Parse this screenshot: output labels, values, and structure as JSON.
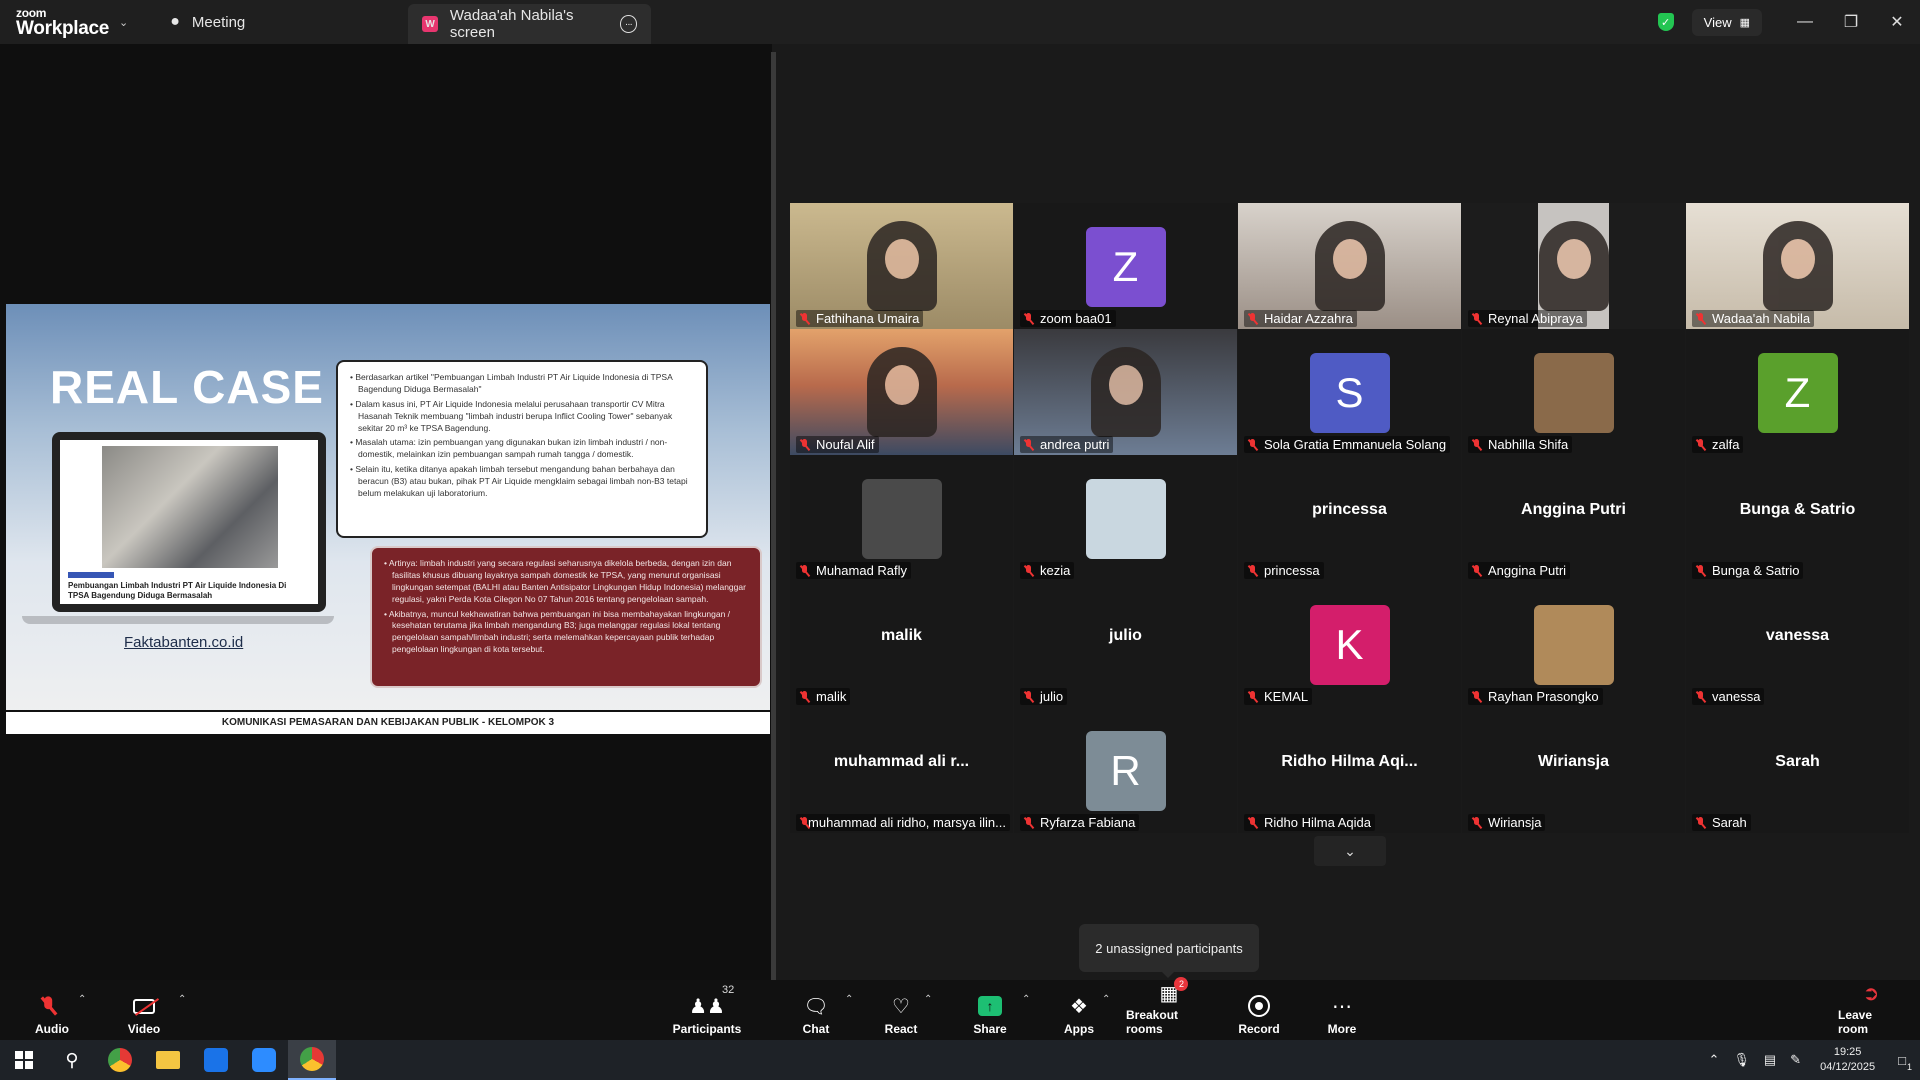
{
  "app": {
    "logo_line1": "zoom",
    "logo_line2": "Workplace",
    "tab_meeting": "Meeting",
    "tab_screen": "Wadaa'ah Nabila's screen",
    "tab_screen_badge": "W",
    "view_label": "View"
  },
  "slide": {
    "title": "REAL CASE",
    "laptop_caption": "Pembuangan Limbah Industri PT Air Liquide Indonesia Di TPSA Bagendung Diduga Bermasalah",
    "link": "Faktabanten.co.id",
    "box1": [
      "Berdasarkan artikel \"Pembuangan Limbah Industri PT Air Liquide Indonesia di TPSA Bagendung Diduga Bermasalah\"",
      "Dalam kasus ini, PT Air Liquide Indonesia melalui perusahaan transportir CV Mitra Hasanah Teknik membuang \"limbah industri berupa Inflict Cooling Tower\" sebanyak sekitar 20 m³ ke TPSA Bagendung.",
      "Masalah utama: izin pembuangan yang digunakan bukan izin limbah industri / non-domestik, melainkan izin pembuangan sampah rumah tangga / domestik.",
      "Selain itu, ketika ditanya apakah limbah tersebut mengandung bahan berbahaya dan beracun (B3) atau bukan, pihak PT Air Liquide mengklaim sebagai limbah non-B3 tetapi belum melakukan uji laboratorium."
    ],
    "box2": [
      "Artinya: limbah industri yang secara regulasi seharusnya dikelola berbeda, dengan izin dan fasilitas khusus dibuang layaknya sampah domestik ke TPSA, yang menurut organisasi lingkungan setempat (BALHI atau Banten Antisipator Lingkungan Hidup Indonesia) melanggar regulasi, yakni Perda Kota Cilegon No 07 Tahun 2016 tentang pengelolaan sampah.",
      "Akibatnya, muncul kekhawatiran bahwa pembuangan ini bisa membahayakan lingkungan / kesehatan terutama jika limbah mengandung B3; juga melanggar regulasi lokal tentang pengelolaan sampah/limbah industri; serta melemahkan kepercayaan publik terhadap pengelolaan lingkungan di kota tersebut."
    ],
    "footer": "KOMUNIKASI PEMASARAN DAN KEBIJAKAN PUBLIK - KELOMPOK 3"
  },
  "participants": [
    {
      "name": "Fathihana Umaira",
      "kind": "video",
      "style": "v1",
      "active": true
    },
    {
      "name": "zoom baa01",
      "kind": "letter",
      "letter": "Z",
      "color": "#7b4fd0"
    },
    {
      "name": "Haidar Azzahra",
      "kind": "video",
      "style": "v3"
    },
    {
      "name": "Reynal Abipraya",
      "kind": "video",
      "style": "v4"
    },
    {
      "name": "Wadaa'ah Nabila",
      "kind": "video",
      "style": "v5"
    },
    {
      "name": "Noufal Alif",
      "kind": "video",
      "style": "v6"
    },
    {
      "name": "andrea putri",
      "kind": "video",
      "style": "v7"
    },
    {
      "name": "Sola Gratia Emmanuela Solang",
      "kind": "letter",
      "letter": "S",
      "color": "#4f5bc4"
    },
    {
      "name": "Nabhilla Shifa",
      "kind": "pic",
      "color": "#8a6a4a"
    },
    {
      "name": "zalfa",
      "kind": "letter",
      "letter": "Z",
      "color": "#5aa02c"
    },
    {
      "name": "Muhamad Rafly",
      "kind": "pic",
      "color": "#4a4a4a"
    },
    {
      "name": "kezia",
      "kind": "pic",
      "color": "#c9d7e0"
    },
    {
      "name": "princessa",
      "kind": "text",
      "display": "princessa"
    },
    {
      "name": "Anggina Putri",
      "kind": "text",
      "display": "Anggina Putri"
    },
    {
      "name": "Bunga & Satrio",
      "kind": "text",
      "display": "Bunga & Satrio"
    },
    {
      "name": "malik",
      "kind": "text",
      "display": "malik"
    },
    {
      "name": "julio",
      "kind": "text",
      "display": "julio"
    },
    {
      "name": "KEMAL",
      "kind": "letter",
      "letter": "K",
      "color": "#d41e6b"
    },
    {
      "name": "Rayhan Prasongko",
      "kind": "pic",
      "color": "#b08a5a"
    },
    {
      "name": "vanessa",
      "kind": "text",
      "display": "vanessa"
    },
    {
      "name": "muhammad ali ridho, marsya ilin...",
      "kind": "text",
      "display": "muhammad ali r..."
    },
    {
      "name": "Ryfarza Fabiana",
      "kind": "letter",
      "letter": "R",
      "color": "#7d8c96"
    },
    {
      "name": "Ridho Hilma Aqida",
      "kind": "text",
      "display": "Ridho Hilma Aqi..."
    },
    {
      "name": "Wiriansja",
      "kind": "text",
      "display": "Wiriansja"
    },
    {
      "name": "Sarah",
      "kind": "text",
      "display": "Sarah"
    }
  ],
  "tooltip": "2 unassigned participants",
  "toolbar": {
    "audio": "Audio",
    "video": "Video",
    "participants": "Participants",
    "participants_count": "32",
    "chat": "Chat",
    "react": "React",
    "share": "Share",
    "apps": "Apps",
    "breakout": "Breakout rooms",
    "breakout_badge": "2",
    "record": "Record",
    "more": "More",
    "leave": "Leave room"
  },
  "taskbar": {
    "time": "19:25",
    "date": "04/12/2025",
    "notif_count": "1"
  }
}
